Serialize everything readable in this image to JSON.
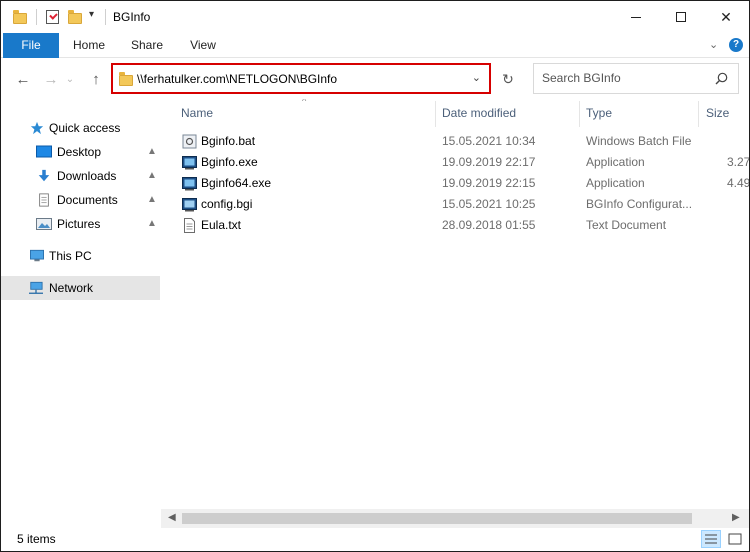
{
  "window": {
    "title": "BGInfo",
    "qa_dropdown": "▾",
    "minimize": "",
    "maximize": "",
    "close": "✕"
  },
  "ribbon": {
    "tabs": [
      "File",
      "Home",
      "Share",
      "View"
    ],
    "collapse": "⌄",
    "help": "?"
  },
  "nav": {
    "back": "←",
    "forward": "→",
    "recent": "⌄",
    "up": "↑",
    "address": "\\\\ferhatulker.com\\NETLOGON\\BGInfo",
    "address_dropdown": "⌄",
    "refresh": "↻",
    "search_placeholder": "Search BGInfo"
  },
  "sidebar": {
    "items": [
      {
        "label": "Quick access",
        "icon": "star-icon",
        "pinned": false
      },
      {
        "label": "Desktop",
        "icon": "desktop-icon",
        "pinned": true
      },
      {
        "label": "Downloads",
        "icon": "download-icon",
        "pinned": true
      },
      {
        "label": "Documents",
        "icon": "documents-icon",
        "pinned": true
      },
      {
        "label": "Pictures",
        "icon": "pictures-icon",
        "pinned": true
      },
      {
        "label": "This PC",
        "icon": "computer-icon",
        "pinned": false
      },
      {
        "label": "Network",
        "icon": "network-icon",
        "pinned": false
      }
    ],
    "pin_glyph": "📌"
  },
  "columns": {
    "name": "Name",
    "date": "Date modified",
    "type": "Type",
    "size": "Size",
    "sort_indicator": "^"
  },
  "files": [
    {
      "name": "Bginfo.bat",
      "date": "15.05.2021 10:34",
      "type": "Windows Batch File",
      "size": "",
      "icon": "batch-file-icon"
    },
    {
      "name": "Bginfo.exe",
      "date": "19.09.2019 22:17",
      "type": "Application",
      "size": "3.27",
      "icon": "application-icon"
    },
    {
      "name": "Bginfo64.exe",
      "date": "19.09.2019 22:15",
      "type": "Application",
      "size": "4.49",
      "icon": "application-icon"
    },
    {
      "name": "config.bgi",
      "date": "15.05.2021 10:25",
      "type": "BGInfo Configurat...",
      "size": "",
      "icon": "bgi-file-icon"
    },
    {
      "name": "Eula.txt",
      "date": "28.09.2018 01:55",
      "type": "Text Document",
      "size": "",
      "icon": "text-file-icon"
    }
  ],
  "status": {
    "items_count": "5 items"
  },
  "colors": {
    "file_tab": "#1979ca",
    "address_highlight": "#d60000",
    "selected_bg": "#cce8ff",
    "hover_bg": "#e5e5e5"
  }
}
